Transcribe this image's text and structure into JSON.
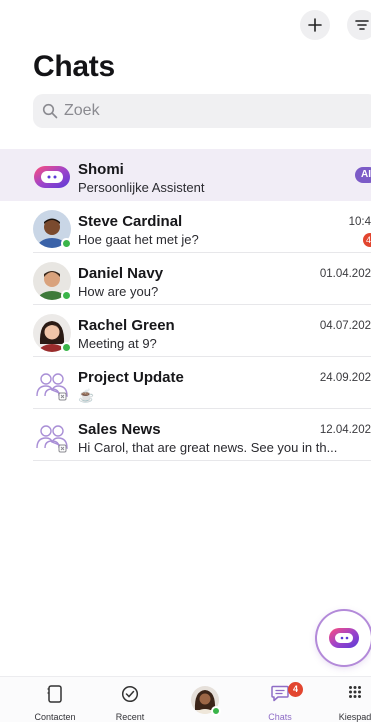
{
  "header": {
    "title": "Chats",
    "add_icon": "plus-icon",
    "filter_icon": "filter-icon"
  },
  "search": {
    "placeholder": "Zoek"
  },
  "chats": [
    {
      "name": "Shomi",
      "message": "Persoonlijke Assistent",
      "date": "",
      "badge": "AI",
      "avatar": "assistant-logo",
      "highlighted": true
    },
    {
      "name": "Steve Cardinal",
      "message": "Hoe gaat het met je?",
      "date": "10:4",
      "unread": "4",
      "avatar": "photo"
    },
    {
      "name": "Daniel Navy",
      "message": "How are you?",
      "date": "01.04.202",
      "avatar": "photo"
    },
    {
      "name": "Rachel Green",
      "message": "Meeting at 9?",
      "date": "04.07.202",
      "avatar": "photo"
    },
    {
      "name": "Project Update",
      "message": "☕",
      "date": "24.09.202",
      "avatar": "group-icon"
    },
    {
      "name": "Sales News",
      "message": "Hi Carol, that are great news. See you in th...",
      "date": "12.04.202",
      "avatar": "group-icon"
    }
  ],
  "tabbar": {
    "tabs": [
      {
        "label": "Contacten",
        "icon": "phone-book-icon"
      },
      {
        "label": "Recent",
        "icon": "recent-check-icon"
      },
      {
        "label": "",
        "icon": "profile-avatar"
      },
      {
        "label": "Chats",
        "icon": "chat-bubble-icon",
        "badge": "4",
        "active": true
      },
      {
        "label": "Kiespad",
        "icon": "dialpad-icon"
      }
    ]
  },
  "colors": {
    "accent": "#8e6cc6",
    "highlight_row": "#f1edf6",
    "badge_red": "#e2452f",
    "presence_green": "#3bb54a"
  }
}
